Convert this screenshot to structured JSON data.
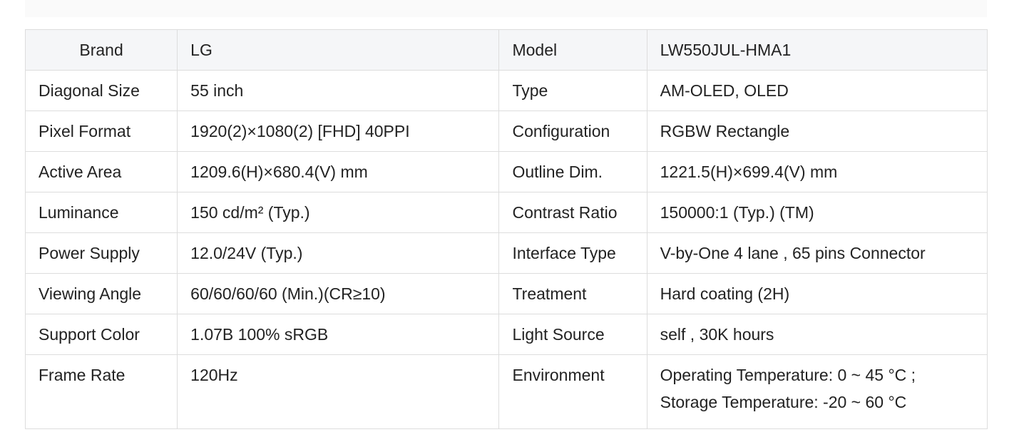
{
  "table": {
    "header": {
      "brand_label": "Brand",
      "brand_value": "LG",
      "model_label": "Model",
      "model_value": "LW550JUL-HMA1"
    },
    "rows": [
      {
        "label1": "Diagonal Size",
        "value1": "55 inch",
        "label2": "Type",
        "value2": "AM-OLED, OLED"
      },
      {
        "label1": "Pixel Format",
        "value1": "1920(2)×1080(2) [FHD] 40PPI",
        "label2": "Configuration",
        "value2": "RGBW Rectangle"
      },
      {
        "label1": "Active Area",
        "value1": "1209.6(H)×680.4(V) mm",
        "label2": "Outline Dim.",
        "value2": "1221.5(H)×699.4(V) mm"
      },
      {
        "label1": "Luminance",
        "value1": "150 cd/m² (Typ.)",
        "label2": "Contrast Ratio",
        "value2": "150000:1 (Typ.) (TM)"
      },
      {
        "label1": "Power Supply",
        "value1": "12.0/24V (Typ.)",
        "label2": "Interface Type",
        "value2": "V-by-One 4 lane , 65 pins Connector"
      },
      {
        "label1": "Viewing Angle",
        "value1": "60/60/60/60 (Min.)(CR≥10)",
        "label2": "Treatment",
        "value2": "Hard coating (2H)"
      },
      {
        "label1": "Support Color",
        "value1": "1.07B 100% sRGB",
        "label2": "Light Source",
        "value2": "self , 30K hours"
      }
    ],
    "last_row": {
      "label1": "Frame Rate",
      "value1": "120Hz",
      "label2": "Environment",
      "value2_line1": "Operating Temperature: 0 ~ 45 °C ;",
      "value2_line2": "Storage Temperature: -20 ~ 60 °C"
    }
  }
}
